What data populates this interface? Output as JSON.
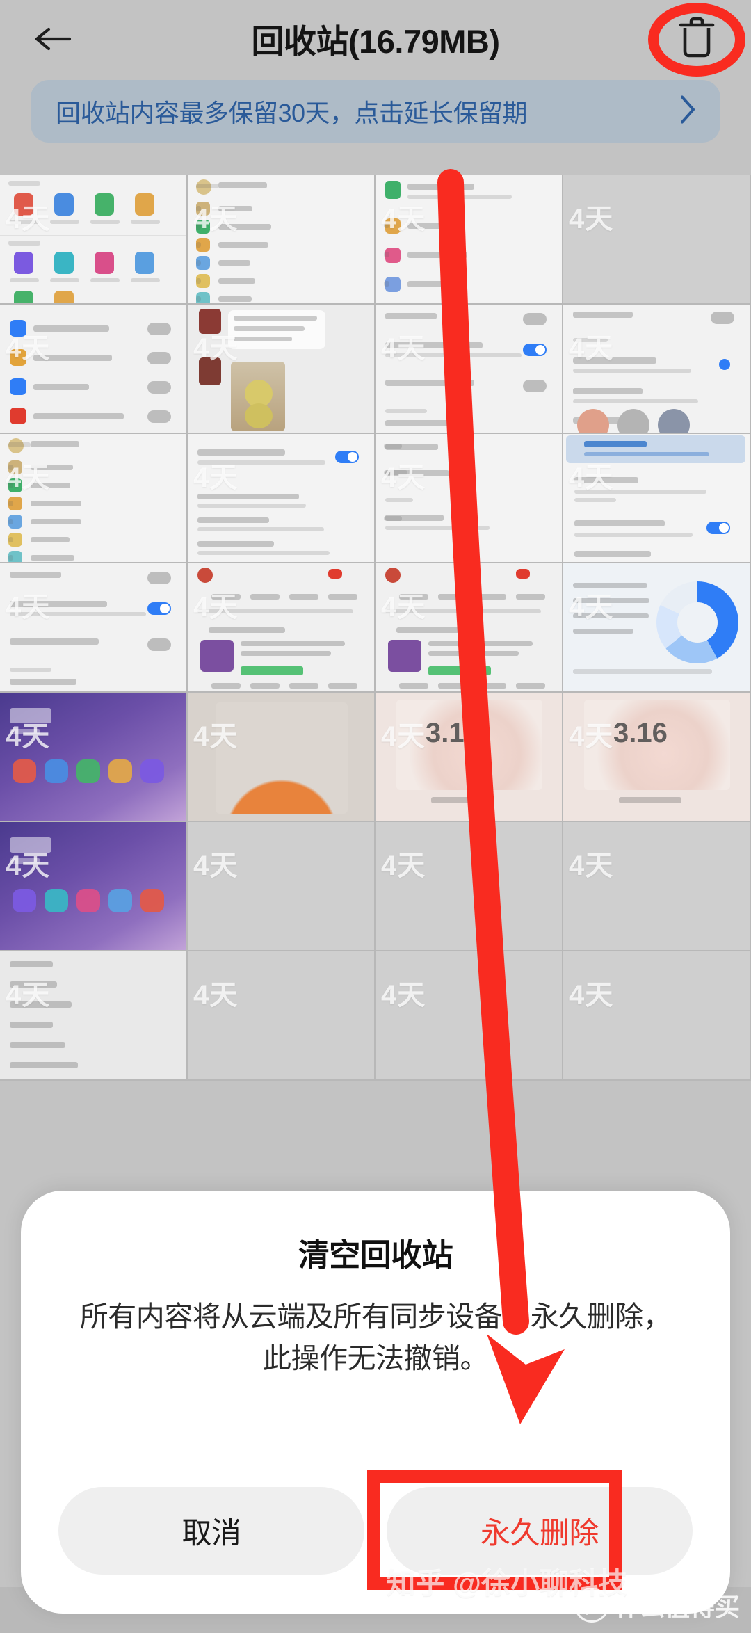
{
  "header": {
    "back_icon": "back-arrow-icon",
    "title": "回收站(16.79MB)",
    "trash_icon": "trash-icon"
  },
  "banner": {
    "text": "回收站内容最多保留30天，点击延长保留期",
    "chevron_icon": "chevron-right-icon",
    "bg_color": "#aebbc7",
    "text_color": "#2a5a99"
  },
  "grid": {
    "day_label": "4天",
    "columns": 4,
    "items": [
      {
        "day": "4天",
        "kind": "app-grid"
      },
      {
        "day": "4天",
        "kind": "settings-list"
      },
      {
        "day": "4天",
        "kind": "short-list"
      },
      {
        "day": "4天",
        "kind": "blank"
      },
      {
        "day": "4天",
        "kind": "toggle-list"
      },
      {
        "day": "4天",
        "kind": "chat-photo"
      },
      {
        "day": "4天",
        "kind": "eyecare-toggles"
      },
      {
        "day": "4天",
        "kind": "wallpaper-toggles"
      },
      {
        "day": "4天",
        "kind": "settings-list"
      },
      {
        "day": "4天",
        "kind": "brightness"
      },
      {
        "day": "4天",
        "kind": "display-style"
      },
      {
        "day": "4天",
        "kind": "eyecare-banner"
      },
      {
        "day": "4天",
        "kind": "eyecare-detail"
      },
      {
        "day": "4天",
        "kind": "order-list"
      },
      {
        "day": "4天",
        "kind": "order-list"
      },
      {
        "day": "4天",
        "kind": "storage-chart"
      },
      {
        "day": "4天",
        "kind": "homescreen"
      },
      {
        "day": "4天",
        "kind": "photo-orange"
      },
      {
        "day": "4天",
        "kind": "app-cache"
      },
      {
        "day": "4天",
        "kind": "app-cache"
      },
      {
        "day": "4天",
        "kind": "homescreen"
      },
      {
        "day": "4天",
        "kind": "blank"
      },
      {
        "day": "4天",
        "kind": "blank"
      },
      {
        "day": "4天",
        "kind": "blank"
      },
      {
        "day": "4天",
        "kind": "accessibility-list"
      },
      {
        "day": "4天",
        "kind": "blank"
      },
      {
        "day": "4天",
        "kind": "blank"
      },
      {
        "day": "4天",
        "kind": "blank"
      }
    ]
  },
  "dialog": {
    "title": "清空回收站",
    "message": "所有内容将从云端及所有同步设备中永久删除，此操作无法撤销。",
    "cancel_label": "取消",
    "confirm_label": "永久删除",
    "confirm_color": "#ef3a2e"
  },
  "annotations": {
    "ellipse_target": "trash-icon",
    "arrow_target": "permanent-delete-button",
    "rect_target": "permanent-delete-button",
    "color": "#f92b20"
  },
  "watermarks": {
    "primary": "知乎 @徐小聊科技",
    "secondary": "什么值得买",
    "secondary_logo_glyph": "值"
  }
}
